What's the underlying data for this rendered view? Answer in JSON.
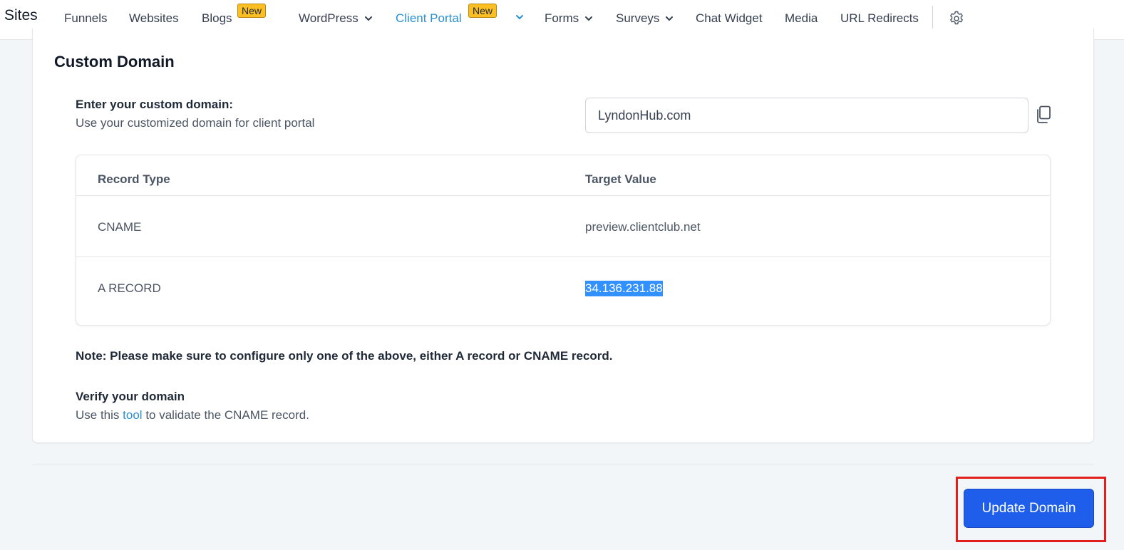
{
  "nav": {
    "brand": "Sites",
    "items": [
      {
        "label": "Funnels"
      },
      {
        "label": "Websites"
      },
      {
        "label": "Blogs",
        "badge": "New"
      },
      {
        "label": "WordPress"
      },
      {
        "label": "Client Portal",
        "badge": "New"
      },
      {
        "label": "Forms"
      },
      {
        "label": "Surveys"
      },
      {
        "label": "Chat Widget"
      },
      {
        "label": "Media"
      },
      {
        "label": "URL Redirects"
      }
    ],
    "active": "Client Portal",
    "accent_color": "#2b8fd6"
  },
  "custom_domain": {
    "title": "Custom Domain",
    "field_label": "Enter your custom domain:",
    "field_help": "Use your customized domain for client portal",
    "value": "LyndonHub.com"
  },
  "dns_table": {
    "headers": [
      "Record Type",
      "Target Value"
    ],
    "rows": [
      {
        "type": "CNAME",
        "value": "preview.clientclub.net"
      },
      {
        "type": "A RECORD",
        "value": "34.136.231.88"
      }
    ]
  },
  "note": "Note: Please make sure to configure only one of the above, either A record or CNAME record.",
  "verify": {
    "title": "Verify your domain",
    "prefix": "Use this",
    "link_text": "tool",
    "suffix": "to validate the CNAME record."
  },
  "actions": {
    "update_label": "Update Domain",
    "button_color": "#1e5eea",
    "highlight_color": "#e11d1d"
  },
  "icons": {
    "settings": "gear-icon",
    "copy": "copy-icon",
    "dropdown": "chevron-down-icon"
  }
}
